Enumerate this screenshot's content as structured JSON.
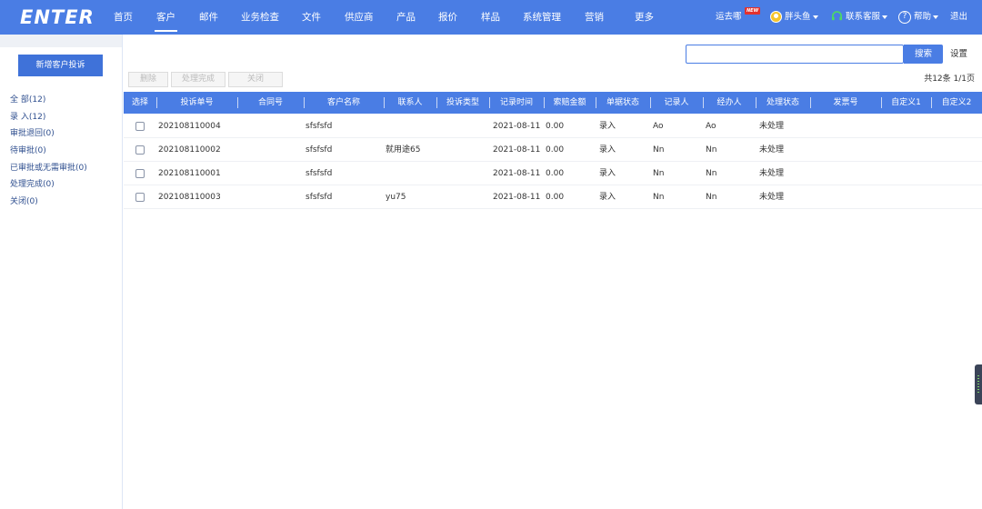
{
  "brand": {
    "logo_text": "ENTER"
  },
  "nav": {
    "items": [
      "首页",
      "客户",
      "邮件",
      "业务检查",
      "文件",
      "供应商",
      "产品",
      "报价",
      "样品",
      "系统管理",
      "营销",
      "更多"
    ],
    "active": "客户"
  },
  "header_right": {
    "yunqu": "运去哪",
    "new_badge": "NEW",
    "user": "胖头鱼",
    "service": "联系客服",
    "help": "帮助",
    "logout": "退出"
  },
  "sidebar": {
    "add_button": "新增客户投诉",
    "items": [
      "全 部(12)",
      "录 入(12)",
      "审批退回(0)",
      "待审批(0)",
      "已审批或无需审批(0)",
      "处理完成(0)",
      "关闭(0)"
    ]
  },
  "search": {
    "placeholder": "",
    "button": "搜索",
    "settings": "设置"
  },
  "toolbar": {
    "delete": "删除",
    "done": "处理完成",
    "close": "关闭"
  },
  "paging": "共12条 1/1页",
  "table": {
    "columns": [
      "选择",
      "投诉单号",
      "合同号",
      "客户名称",
      "联系人",
      "投诉类型",
      "记录时间",
      "索赔金额",
      "单据状态",
      "记录人",
      "经办人",
      "处理状态",
      "发票号",
      "自定义1",
      "自定义2"
    ],
    "rows": [
      [
        "202108110004",
        "",
        "sfsfsfd",
        "",
        "",
        "2021-08-11",
        "0.00",
        "录入",
        "Ao",
        "Ao",
        "未处理",
        "",
        "",
        ""
      ],
      [
        "202108110002",
        "",
        "sfsfsfd",
        "就用途65",
        "",
        "2021-08-11",
        "0.00",
        "录入",
        "Nn",
        "Nn",
        "未处理",
        "",
        "",
        ""
      ],
      [
        "202108110001",
        "",
        "sfsfsfd",
        "",
        "",
        "2021-08-11",
        "0.00",
        "录入",
        "Nn",
        "Nn",
        "未处理",
        "",
        "",
        ""
      ],
      [
        "202108110003",
        "",
        "sfsfsfd",
        "yu75",
        "",
        "2021-08-11",
        "0.00",
        "录入",
        "Nn",
        "Nn",
        "未处理",
        "",
        "",
        ""
      ]
    ]
  },
  "colors": {
    "primary": "#4a7de4",
    "button": "#3f72d9",
    "badge": "#e3312d"
  }
}
